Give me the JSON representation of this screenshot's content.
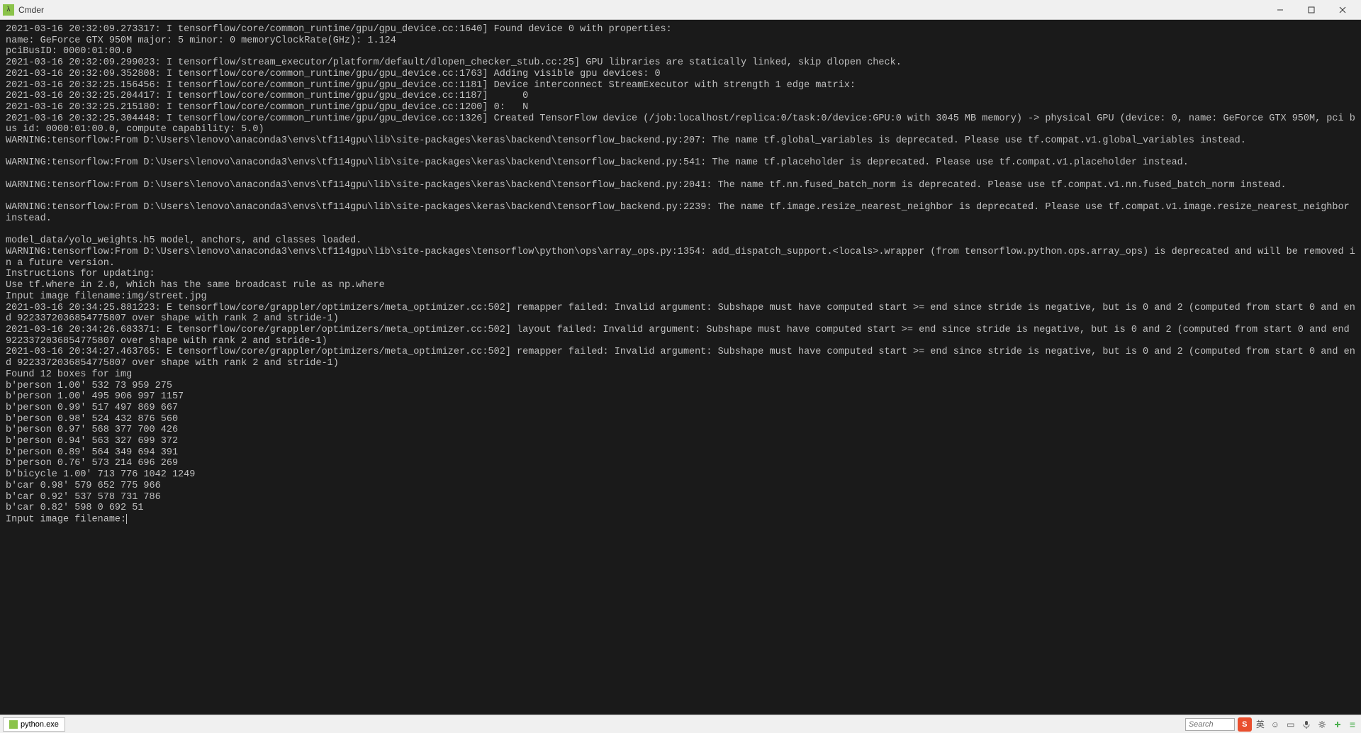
{
  "window": {
    "title": "Cmder"
  },
  "terminal_output": "2021-03-16 20:32:09.273317: I tensorflow/core/common_runtime/gpu/gpu_device.cc:1640] Found device 0 with properties:\nname: GeForce GTX 950M major: 5 minor: 0 memoryClockRate(GHz): 1.124\npciBusID: 0000:01:00.0\n2021-03-16 20:32:09.299023: I tensorflow/stream_executor/platform/default/dlopen_checker_stub.cc:25] GPU libraries are statically linked, skip dlopen check.\n2021-03-16 20:32:09.352808: I tensorflow/core/common_runtime/gpu/gpu_device.cc:1763] Adding visible gpu devices: 0\n2021-03-16 20:32:25.156456: I tensorflow/core/common_runtime/gpu/gpu_device.cc:1181] Device interconnect StreamExecutor with strength 1 edge matrix:\n2021-03-16 20:32:25.204417: I tensorflow/core/common_runtime/gpu/gpu_device.cc:1187]      0\n2021-03-16 20:32:25.215180: I tensorflow/core/common_runtime/gpu/gpu_device.cc:1200] 0:   N\n2021-03-16 20:32:25.304448: I tensorflow/core/common_runtime/gpu/gpu_device.cc:1326] Created TensorFlow device (/job:localhost/replica:0/task:0/device:GPU:0 with 3045 MB memory) -> physical GPU (device: 0, name: GeForce GTX 950M, pci bus id: 0000:01:00.0, compute capability: 5.0)\nWARNING:tensorflow:From D:\\Users\\lenovo\\anaconda3\\envs\\tf114gpu\\lib\\site-packages\\keras\\backend\\tensorflow_backend.py:207: The name tf.global_variables is deprecated. Please use tf.compat.v1.global_variables instead.\n\nWARNING:tensorflow:From D:\\Users\\lenovo\\anaconda3\\envs\\tf114gpu\\lib\\site-packages\\keras\\backend\\tensorflow_backend.py:541: The name tf.placeholder is deprecated. Please use tf.compat.v1.placeholder instead.\n\nWARNING:tensorflow:From D:\\Users\\lenovo\\anaconda3\\envs\\tf114gpu\\lib\\site-packages\\keras\\backend\\tensorflow_backend.py:2041: The name tf.nn.fused_batch_norm is deprecated. Please use tf.compat.v1.nn.fused_batch_norm instead.\n\nWARNING:tensorflow:From D:\\Users\\lenovo\\anaconda3\\envs\\tf114gpu\\lib\\site-packages\\keras\\backend\\tensorflow_backend.py:2239: The name tf.image.resize_nearest_neighbor is deprecated. Please use tf.compat.v1.image.resize_nearest_neighbor instead.\n\nmodel_data/yolo_weights.h5 model, anchors, and classes loaded.\nWARNING:tensorflow:From D:\\Users\\lenovo\\anaconda3\\envs\\tf114gpu\\lib\\site-packages\\tensorflow\\python\\ops\\array_ops.py:1354: add_dispatch_support.<locals>.wrapper (from tensorflow.python.ops.array_ops) is deprecated and will be removed in a future version.\nInstructions for updating:\nUse tf.where in 2.0, which has the same broadcast rule as np.where\nInput image filename:img/street.jpg\n2021-03-16 20:34:25.881223: E tensorflow/core/grappler/optimizers/meta_optimizer.cc:502] remapper failed: Invalid argument: Subshape must have computed start >= end since stride is negative, but is 0 and 2 (computed from start 0 and end 9223372036854775807 over shape with rank 2 and stride-1)\n2021-03-16 20:34:26.683371: E tensorflow/core/grappler/optimizers/meta_optimizer.cc:502] layout failed: Invalid argument: Subshape must have computed start >= end since stride is negative, but is 0 and 2 (computed from start 0 and end 9223372036854775807 over shape with rank 2 and stride-1)\n2021-03-16 20:34:27.463765: E tensorflow/core/grappler/optimizers/meta_optimizer.cc:502] remapper failed: Invalid argument: Subshape must have computed start >= end since stride is negative, but is 0 and 2 (computed from start 0 and end 9223372036854775807 over shape with rank 2 and stride-1)\nFound 12 boxes for img\nb'person 1.00' 532 73 959 275\nb'person 1.00' 495 906 997 1157\nb'person 0.99' 517 497 869 667\nb'person 0.98' 524 432 876 560\nb'person 0.97' 568 377 700 426\nb'person 0.94' 563 327 699 372\nb'person 0.89' 564 349 694 391\nb'person 0.76' 573 214 696 269\nb'bicycle 1.00' 713 776 1042 1249\nb'car 0.98' 579 652 775 966\nb'car 0.92' 537 578 731 786\nb'car 0.82' 598 0 692 51\nInput image filename:",
  "statusbar": {
    "tab_label": "python.exe",
    "search_placeholder": "Search",
    "ime_letter": "S",
    "cn_label": "英"
  }
}
